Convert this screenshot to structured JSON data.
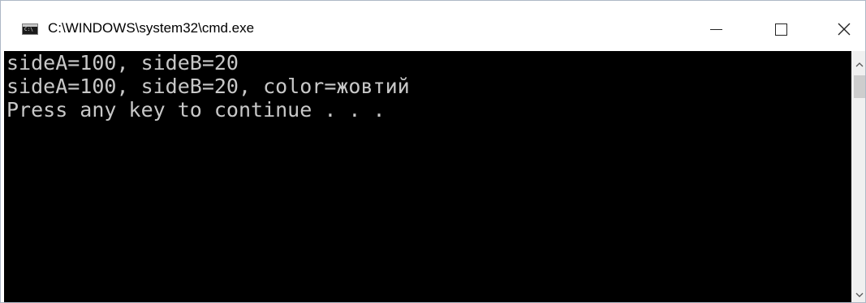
{
  "window": {
    "title": "C:\\WINDOWS\\system32\\cmd.exe",
    "icon": "cmd-icon",
    "icon_prompt": "C:\\"
  },
  "controls": {
    "minimize_icon": "minimize-icon",
    "maximize_icon": "maximize-icon",
    "close_icon": "close-icon"
  },
  "console": {
    "lines": [
      "sideA=100, sideB=20",
      "sideA=100, sideB=20, color=жовтий",
      "Press any key to continue . . ."
    ],
    "background": "#000000",
    "foreground": "#c8c8c8"
  },
  "scrollbar": {
    "up_icon": "chevron-up-icon",
    "down_icon": "chevron-down-icon"
  }
}
